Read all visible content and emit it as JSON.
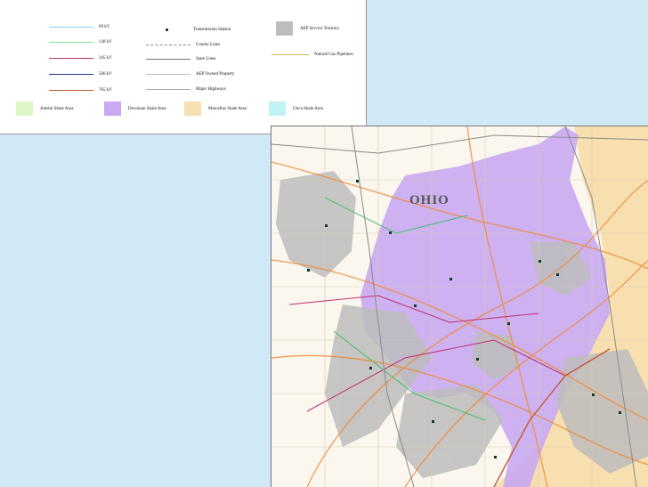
{
  "legend": {
    "voltage_lines": [
      {
        "label": "69 kV",
        "color": "#7fd6e8"
      },
      {
        "label": "138 kV",
        "color": "#86e08f"
      },
      {
        "label": "345 kV",
        "color": "#c03070"
      },
      {
        "label": "500 kV",
        "color": "#223a8f"
      },
      {
        "label": "765 kV",
        "color": "#c05a3a"
      }
    ],
    "symbols": [
      {
        "label": "Transmission Station",
        "kind": "dot"
      },
      {
        "label": "County Lines",
        "kind": "dashed",
        "color": "#888888"
      },
      {
        "label": "State Lines",
        "kind": "line",
        "color": "#777777"
      },
      {
        "label": "AEP Owned Property",
        "kind": "line",
        "color": "#bbbbbb"
      },
      {
        "label": "Major Highways",
        "kind": "line",
        "color": "#aaaaaa"
      }
    ],
    "territory": {
      "label": "AEP Service Territory",
      "color": "#bdbdbd"
    },
    "pipelines": {
      "label": "Natural Gas Pipelines",
      "color": "#d8b35a"
    },
    "shale_areas": [
      {
        "label": "Antrim Shale Area",
        "color": "#ddf7c8"
      },
      {
        "label": "Devonian Shale Area",
        "color": "#c9a9f1"
      },
      {
        "label": "Marcellus Shale Area",
        "color": "#f8dfb0"
      },
      {
        "label": "Utica Shale Area",
        "color": "#bff3f7"
      }
    ]
  },
  "map": {
    "state_label": "OHIO",
    "colors": {
      "background": "#fbf7ee",
      "devonian": "#c9a9f1",
      "marcellus": "#f8dfb0",
      "territory": "#bdbdbd",
      "pipeline": "#f08a3a",
      "line_345": "#c03070",
      "line_138": "#3fbf6f",
      "line_765": "#c05a3a",
      "station": "#0a3a2a"
    }
  }
}
